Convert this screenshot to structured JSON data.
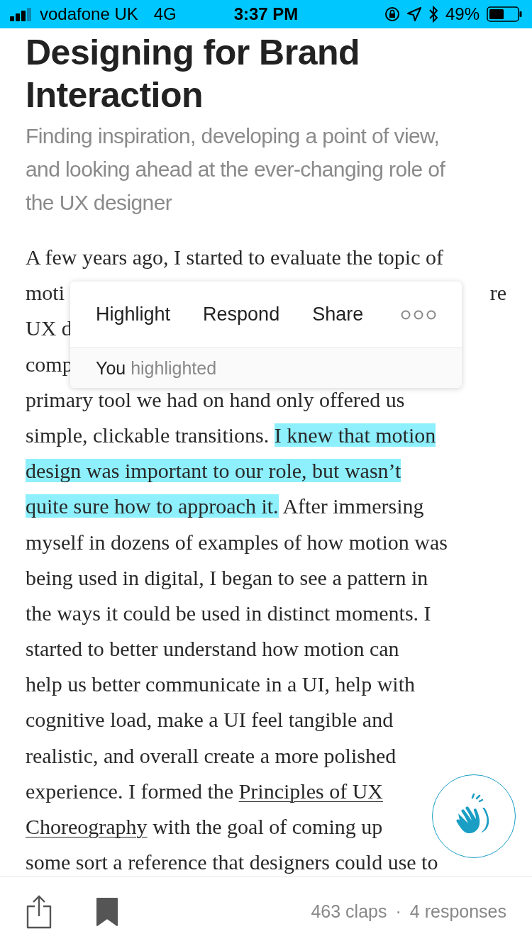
{
  "status_bar": {
    "carrier": "vodafone UK",
    "network": "4G",
    "time": "3:37 PM",
    "battery": "49%"
  },
  "article": {
    "title": "Designing for Brand Interaction",
    "subtitle": "Finding inspiration, developing a point of view, and looking ahead at the ever-changing role of the UX designer",
    "lines": [
      [
        {
          "kind": "text",
          "text": "A few years ago, I started to evaluate the topic of"
        }
      ],
      [
        {
          "kind": "text",
          "text": "moti"
        },
        {
          "kind": "right",
          "text": "re"
        }
      ],
      [
        {
          "kind": "text",
          "text": "UX d"
        }
      ],
      [
        {
          "kind": "text",
          "text": "comp"
        }
      ],
      [
        {
          "kind": "text",
          "text": "primary tool we had on hand only offered us"
        }
      ],
      [
        {
          "kind": "text",
          "text": "simple, clickable transitions. "
        },
        {
          "kind": "highlight",
          "text": "I knew that motion"
        }
      ],
      [
        {
          "kind": "highlight",
          "text": "design was important to our role, but wasn’t"
        }
      ],
      [
        {
          "kind": "highlight",
          "text": "quite sure how to approach it."
        },
        {
          "kind": "text",
          "text": " After immersing"
        }
      ],
      [
        {
          "kind": "text",
          "text": "myself in dozens of examples of how motion was"
        }
      ],
      [
        {
          "kind": "text",
          "text": "being used in digital, I began to see a pattern in"
        }
      ],
      [
        {
          "kind": "text",
          "text": "the ways it could be used in distinct moments. I"
        }
      ],
      [
        {
          "kind": "text",
          "text": "started to better understand how motion can"
        }
      ],
      [
        {
          "kind": "text",
          "text": "help us better communicate in a UI, help with"
        }
      ],
      [
        {
          "kind": "text",
          "text": "cognitive load, make a UI feel tangible and"
        }
      ],
      [
        {
          "kind": "text",
          "text": "realistic, and overall create a more polished"
        }
      ],
      [
        {
          "kind": "text",
          "text": "experience. I formed the "
        },
        {
          "kind": "link",
          "text": "Principles of UX"
        }
      ],
      [
        {
          "kind": "link",
          "text": "Choreography"
        },
        {
          "kind": "text",
          "text": " with the goal of coming up"
        }
      ],
      [
        {
          "kind": "text",
          "text": "some sort a reference that designers could use to"
        }
      ]
    ]
  },
  "popup": {
    "actions": [
      "Highlight",
      "Respond",
      "Share"
    ],
    "footer_name": "You",
    "footer_text": "highlighted"
  },
  "footer": {
    "claps": "463 claps",
    "separator": "·",
    "responses": "4 responses"
  }
}
